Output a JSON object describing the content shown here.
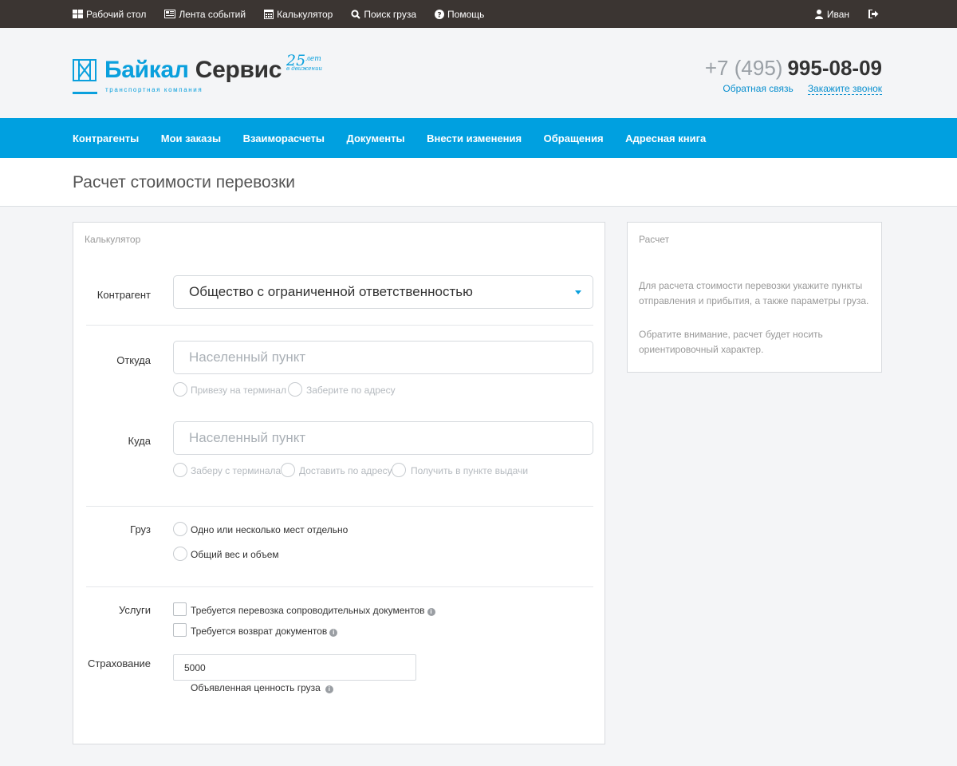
{
  "topbar": {
    "left": [
      {
        "label": "Рабочий стол",
        "icon": "dashboard-icon"
      },
      {
        "label": "Лента событий",
        "icon": "feed-icon"
      },
      {
        "label": "Калькулятор",
        "icon": "calculator-icon"
      },
      {
        "label": "Поиск груза",
        "icon": "search-icon"
      },
      {
        "label": "Помощь",
        "icon": "help-icon"
      }
    ],
    "user": "Иван"
  },
  "header": {
    "brand_part1": "Байкал",
    "brand_part2": "Сервис",
    "tagline": "транспортная компания",
    "badge_number": "25",
    "badge_suffix": "лет",
    "badge_sub": "в движении",
    "phone_code": "+7 (495)",
    "phone_number": "995-08-09",
    "feedback_link": "Обратная связь",
    "callback_link": "Закажите звонок"
  },
  "nav": [
    "Контрагенты",
    "Мои заказы",
    "Взаиморасчеты",
    "Документы",
    "Внести изменения",
    "Обращения",
    "Адресная книга"
  ],
  "page_title": "Расчет стоимости перевозки",
  "calc": {
    "panel_title": "Калькулятор",
    "contractor_label": "Контрагент",
    "contractor_value": "Общество с ограниченной ответственностью",
    "from_label": "Откуда",
    "from_placeholder": "Населенный пункт",
    "from_options": [
      "Привезу на терминал",
      "Заберите по адресу"
    ],
    "to_label": "Куда",
    "to_placeholder": "Населенный пункт",
    "to_options": [
      "Заберу с терминала",
      "Доставить по адресу",
      "Получить в пункте выдачи"
    ],
    "cargo_label": "Груз",
    "cargo_options": [
      "Одно или несколько мест отдельно",
      "Общий вес и объем"
    ],
    "services_label": "Услуги",
    "services": [
      "Требуется перевозка сопроводительных документов",
      "Требуется возврат документов"
    ],
    "insurance_label": "Страхование",
    "insurance_value": "5000",
    "insurance_hint": "Объявленная ценность груза"
  },
  "result": {
    "panel_title": "Расчет",
    "text1": "Для расчета стоимости перевозки укажите пункты отправления и прибытия, а также параметры груза.",
    "text2": "Обратите внимание, расчет будет носить ориентировочный характер."
  },
  "colors": {
    "accent": "#00a0e0",
    "topbar": "#3b3532",
    "link": "#0a90cf"
  }
}
